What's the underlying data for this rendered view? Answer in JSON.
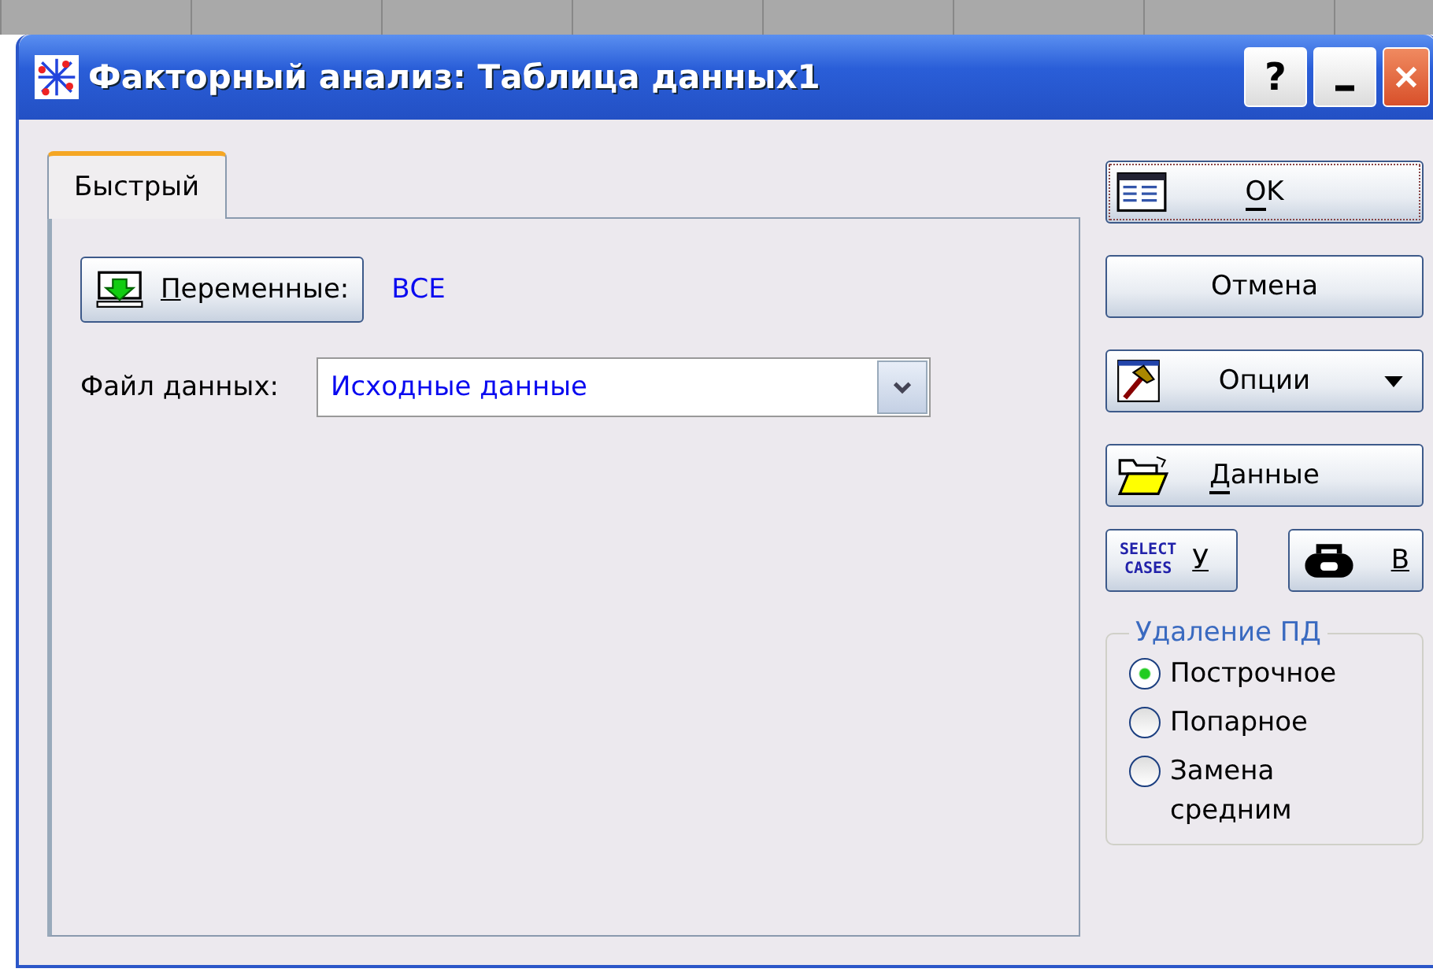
{
  "window": {
    "title": "Факторный анализ: Таблица данных1",
    "controls": [
      "?"
    ]
  },
  "tabs": [
    {
      "label": "Быстрый",
      "selected": true
    }
  ],
  "variables": {
    "button": "Переменные:",
    "value": "ВСЕ"
  },
  "data_file": {
    "label": "Файл данных:",
    "value": "Исходные данные"
  },
  "buttons": [
    {
      "kind": "ok",
      "label": "OK",
      "mnemonic": true,
      "focused": true
    },
    {
      "kind": "cancel",
      "label": "Отмена",
      "mnemonic": false,
      "focused": false
    },
    {
      "kind": "options",
      "label": "Опции",
      "mnemonic": false,
      "focused": false
    },
    {
      "kind": "data",
      "label": "Данные",
      "mnemonic": true,
      "focused": false
    }
  ],
  "small_buttons": [
    {
      "kind": "select",
      "icon_text": [
        "SELECT",
        "CASES"
      ],
      "label": "У"
    },
    {
      "kind": "weight",
      "label": "В"
    }
  ],
  "missing_data": {
    "title": "Удаление ПД",
    "options": [
      {
        "label": "Построчное",
        "selected": true
      },
      {
        "label": "Попарное",
        "selected": false
      },
      {
        "label": "Замена средним",
        "selected": false
      }
    ]
  }
}
